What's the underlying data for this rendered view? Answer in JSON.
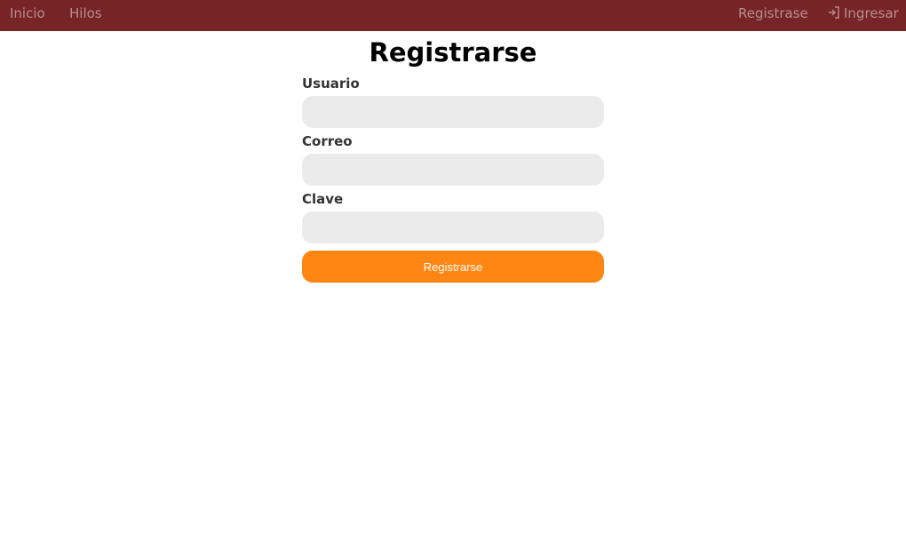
{
  "nav": {
    "home": "Inicio",
    "threads": "Hilos",
    "register": "Registrase",
    "login": "Ingresar",
    "login_icon": "sign-in-icon",
    "background_color": "#772426",
    "link_color": "#b98d8d"
  },
  "page": {
    "title": "Registrarse"
  },
  "form": {
    "username_label": "Usuario",
    "username_value": "",
    "email_label": "Correo",
    "email_value": "",
    "password_label": "Clave",
    "password_value": "",
    "submit_label": "Registrarse",
    "submit_color": "#ff8612",
    "input_background": "#ebebeb"
  }
}
